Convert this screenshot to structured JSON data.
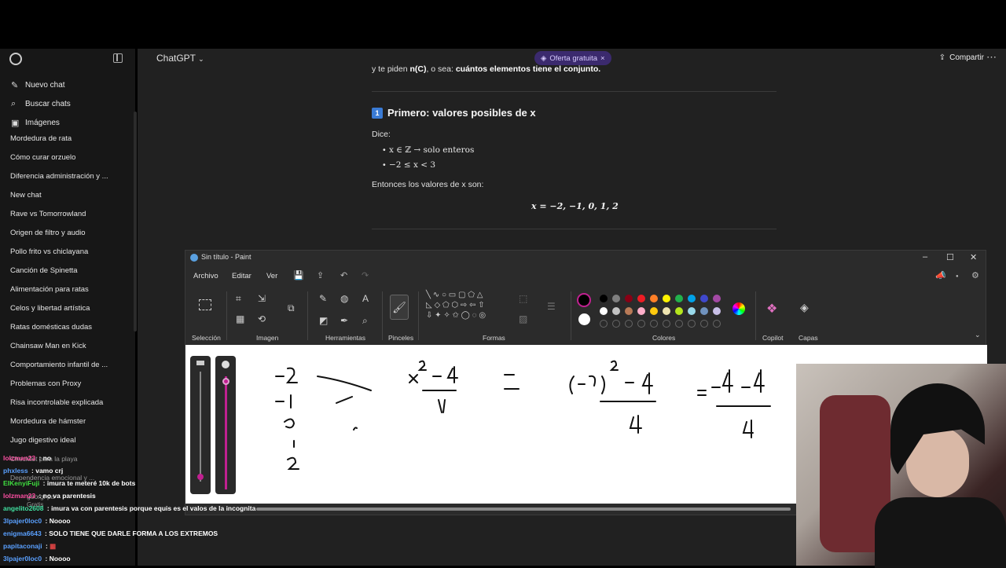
{
  "sidebar": {
    "actions": [
      {
        "label": "Nuevo chat",
        "icon": "edit-icon"
      },
      {
        "label": "Buscar chats",
        "icon": "search-icon"
      },
      {
        "label": "Imágenes",
        "icon": "images-icon"
      }
    ],
    "chats": [
      "Mordedura de rata",
      "Cómo curar orzuelo",
      "Diferencia administración y ...",
      "New chat",
      "Rave vs Tomorrowland",
      "Origen de filtro y audio",
      "Pollo frito vs chiclayana",
      "Canción de Spinetta",
      "Alimentación para ratas",
      "Celos y libertad artística",
      "Ratas domésticas dudas",
      "Chainsaw Man en Kick",
      "Comportamiento infantil de ...",
      "Problemas con Proxy",
      "Risa incontrolable explicada",
      "Mordedura de hámster",
      "Jugo digestivo ideal",
      "Checklist para la playa",
      "Dependencia emocional y ...",
      "georgi pa",
      "Gratis"
    ]
  },
  "header": {
    "model": "ChatGPT",
    "offer": "Oferta gratuita",
    "share": "Compartir"
  },
  "conversation": {
    "intro_prefix": "y te piden ",
    "intro_bold1": "n(C)",
    "intro_mid": ", o sea: ",
    "intro_bold2": "cuántos elementos tiene el conjunto.",
    "section_num": "1",
    "section_title": "Primero: valores posibles de x",
    "says": "Dice:",
    "bullets": [
      "x ∈ ℤ → solo enteros",
      "−2 ≤ x < 3"
    ],
    "then": "Entonces los valores de x son:",
    "equation": "x = −2, −1, 0, 1, 2"
  },
  "paint": {
    "title": "Sin título - Paint",
    "menu": [
      "Archivo",
      "Editar",
      "Ver"
    ],
    "groups": [
      "Selección",
      "Imagen",
      "Herramientas",
      "Pinceles",
      "Formas",
      "Colores",
      "Copilot",
      "Capas"
    ],
    "palette": [
      "#000000",
      "#7f7f7f",
      "#880015",
      "#ed1c24",
      "#ff7f27",
      "#fff200",
      "#22b14c",
      "#00a2e8",
      "#3f48cc",
      "#a349a4",
      "#ffffff",
      "#c3c3c3",
      "#b97a57",
      "#ffaec9",
      "#ffc90e",
      "#efe4b0",
      "#b5e61d",
      "#99d9ea",
      "#7092be",
      "#c8bfe7"
    ]
  },
  "chat_overlay": [
    {
      "user": "lolzman23",
      "color": "#ff4fa3",
      "msg": "no"
    },
    {
      "user": "phxless",
      "color": "#5aa0ff",
      "msg": "vamo crj"
    },
    {
      "user": "ElKenyiFuji",
      "color": "#40e040",
      "msg": "imura te meteré 10k de bots"
    },
    {
      "user": "lolzman23",
      "color": "#ff4fa3",
      "msg": "no va parentesis"
    },
    {
      "user": "angelito2608",
      "color": "#40e0a0",
      "msg": "imura va con parentesis porque equis es el valos de la incognita"
    },
    {
      "user": "3lpajer0loc0",
      "color": "#5aa0ff",
      "msg": "Noooo"
    },
    {
      "user": "enigma6643",
      "color": "#5aa0ff",
      "msg": "SOLO TIENE QUE DARLE FORMA A LOS EXTREMOS"
    },
    {
      "user": "papitaconaji",
      "color": "#5aa0ff",
      "msg": ""
    },
    {
      "user": "3lpajer0loc0",
      "color": "#5aa0ff",
      "msg": "Noooo"
    }
  ]
}
